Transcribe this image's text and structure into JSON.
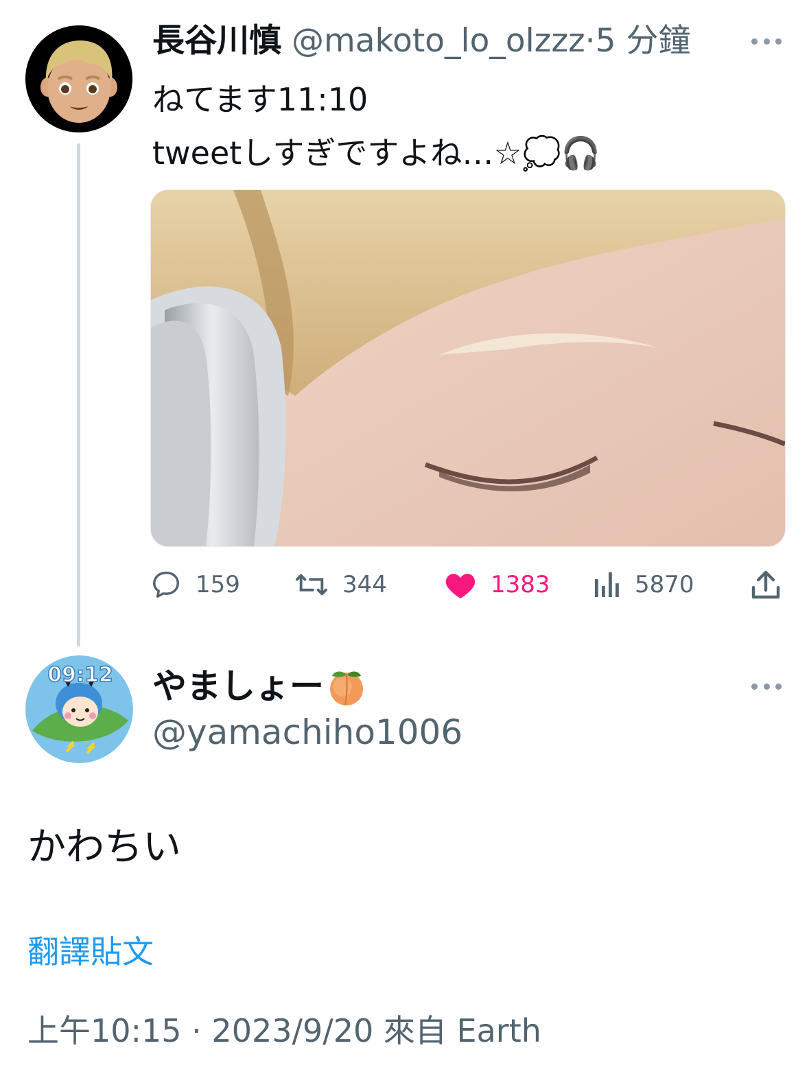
{
  "parent_tweet": {
    "display_name": "長谷川慎",
    "handle": "@makoto_lo_olzzz",
    "time": "·5 分鐘",
    "text_line1": "ねてます11:10",
    "text_line2": "tweetしすぎですよね…☆💭🎧",
    "avatar_icon": "boy-emoji-avatar",
    "actions": {
      "replies": "159",
      "retweets": "344",
      "likes": "1383",
      "views": "5870"
    },
    "like_color": "#f91880"
  },
  "reply_tweet": {
    "display_name": "やましょー",
    "name_emoji": "peach-emoji",
    "handle": "@yamachiho1006",
    "avatar_clock": "09:12",
    "text": "かわちい",
    "translate_label": "翻譯貼文",
    "timestamp": "上午10:15 · 2023/9/20 來自 Earth"
  },
  "colors": {
    "link": "#1d9bf0",
    "secondary_text": "#536471",
    "thread_line": "#cfd9de"
  }
}
